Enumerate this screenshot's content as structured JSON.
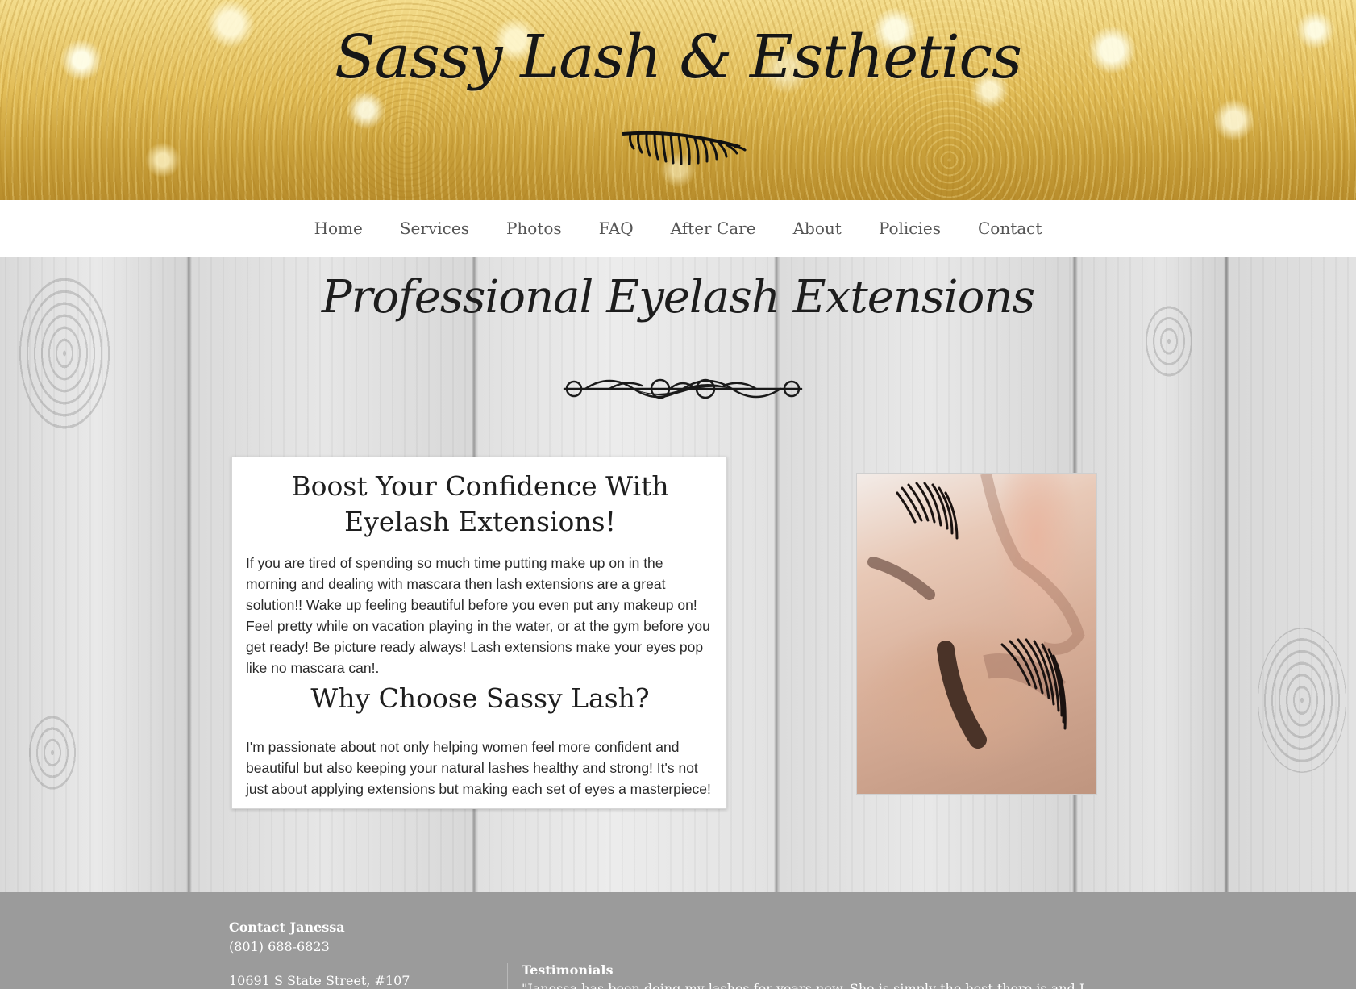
{
  "header": {
    "brand": "Sassy Lash & Esthetics",
    "lash_icon": "eyelash-icon"
  },
  "nav": {
    "items": [
      "Home",
      "Services",
      "Photos",
      "FAQ",
      "After Care",
      "About",
      "Policies",
      "Contact"
    ]
  },
  "main": {
    "title": "Professional Eyelash Extensions",
    "ornament_icon": "scroll-ornament-icon",
    "card": {
      "heading1": "Boost Your Confidence With Eyelash Extensions!",
      "paragraph1": "If you are tired of spending so much time putting make up on in the morning and dealing with mascara then lash extensions are a great solution!! Wake up feeling beautiful before you even put any makeup on! Feel pretty while on vacation playing in the water, or at the gym before you get ready! Be picture ready always! Lash extensions make your eyes pop like no mascara can!.",
      "heading2": "Why Choose Sassy Lash?",
      "paragraph2": "I'm passionate about not only helping women feel more confident and beautiful but also keeping your natural lashes healthy and strong! It's not just about applying extensions but making each set of eyes a masterpiece!"
    }
  },
  "footer": {
    "contact_name": "Contact Janessa",
    "phone": "(801) 688-6823",
    "address": "10691 S State Street, #107",
    "testimonials_label": "Testimonials",
    "testimonial_quote": "\"Janessa has been doing my lashes for years now. She is simply the best there is and I wouldn't go"
  },
  "colors": {
    "nav_bg": "#ffffff",
    "nav_text": "#555555",
    "footer_bg": "#9b9b9b",
    "gold_header": "#d9b24c"
  }
}
